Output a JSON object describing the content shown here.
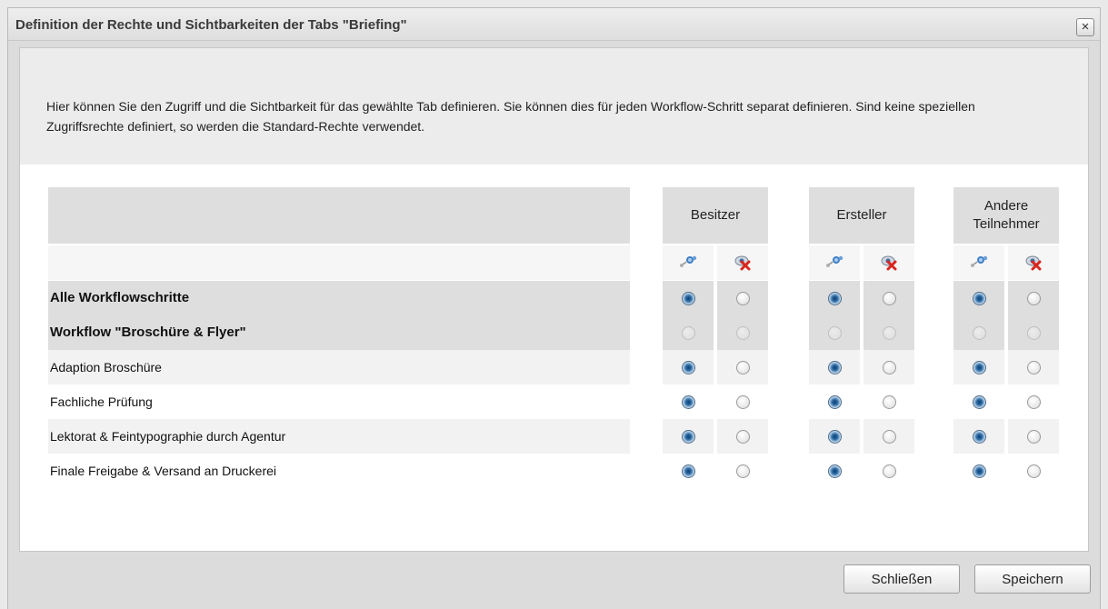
{
  "dialog": {
    "title": "Definition der Rechte und Sichtbarkeiten der Tabs \"Briefing\"",
    "close_glyph": "×",
    "description": "Hier können Sie den Zugriff und die Sichtbarkeit für das gewählte Tab definieren. Sie können dies für jeden Workflow-Schritt separat definieren. Sind keine speziellen Zugriffsrechte definiert, so werden die Standard-Rechte verwendet."
  },
  "columns": {
    "groups": [
      {
        "label": "Besitzer"
      },
      {
        "label": "Ersteller"
      },
      {
        "label": "Andere Teilnehmer"
      }
    ],
    "sub_icons": [
      "access-icon",
      "hidden-icon"
    ]
  },
  "rows": [
    {
      "label": "Alle Workflowschritte",
      "style": "bold",
      "values": [
        "access",
        "access",
        "access"
      ]
    },
    {
      "label": "Workflow \"Broschüre & Flyer\"",
      "style": "bold",
      "values": [
        "none",
        "none",
        "none"
      ]
    },
    {
      "label": "Adaption Broschüre",
      "style": "alt",
      "values": [
        "access",
        "access",
        "access"
      ]
    },
    {
      "label": "Fachliche Prüfung",
      "style": "plain",
      "values": [
        "access",
        "access",
        "access"
      ]
    },
    {
      "label": "Lektorat & Feintypographie durch Agentur",
      "style": "alt",
      "values": [
        "access",
        "access",
        "access"
      ]
    },
    {
      "label": "Finale Freigabe & Versand an Druckerei",
      "style": "plain",
      "values": [
        "access",
        "access",
        "access"
      ]
    }
  ],
  "buttons": {
    "close_label": "Schließen",
    "save_label": "Speichern"
  },
  "colors": {
    "header_gray": "#dedede",
    "radio_selected": "#2a6aa5",
    "hidden_icon_red": "#d9251d"
  }
}
